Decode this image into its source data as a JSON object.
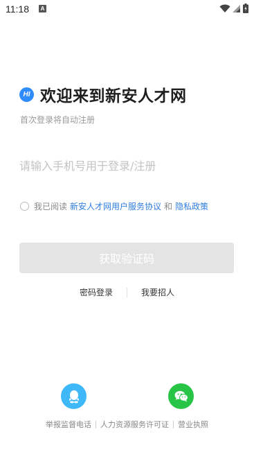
{
  "status_bar": {
    "time": "11:18",
    "notif_letter": "A",
    "icons": [
      "wifi-icon",
      "signal-icon",
      "battery-icon"
    ]
  },
  "header": {
    "logo_text": "HI",
    "title": "欢迎来到新安人才网"
  },
  "subtitle": "首次登录将自动注册",
  "phone_input": {
    "placeholder": "请输入手机号用于登录/注册",
    "value": ""
  },
  "agreement": {
    "prefix": "我已阅读",
    "user_agreement": "新安人才网用户服务协议",
    "and": "和",
    "privacy": "隐私政策"
  },
  "get_code_button": "获取验证码",
  "alt_links": {
    "password_login": "密码登录",
    "recruit": "我要招人"
  },
  "social": [
    "qq-icon",
    "wechat-icon"
  ],
  "footer": {
    "report_phone": "举报监督电话",
    "hr_license": "人力资源服务许可证",
    "business_license": "营业执照"
  },
  "colors": {
    "accent": "#2f7de1",
    "logo": "#2f8cff",
    "qq": "#3eb8f8",
    "wechat": "#28c445",
    "button_disabled": "#e4e4e4"
  }
}
